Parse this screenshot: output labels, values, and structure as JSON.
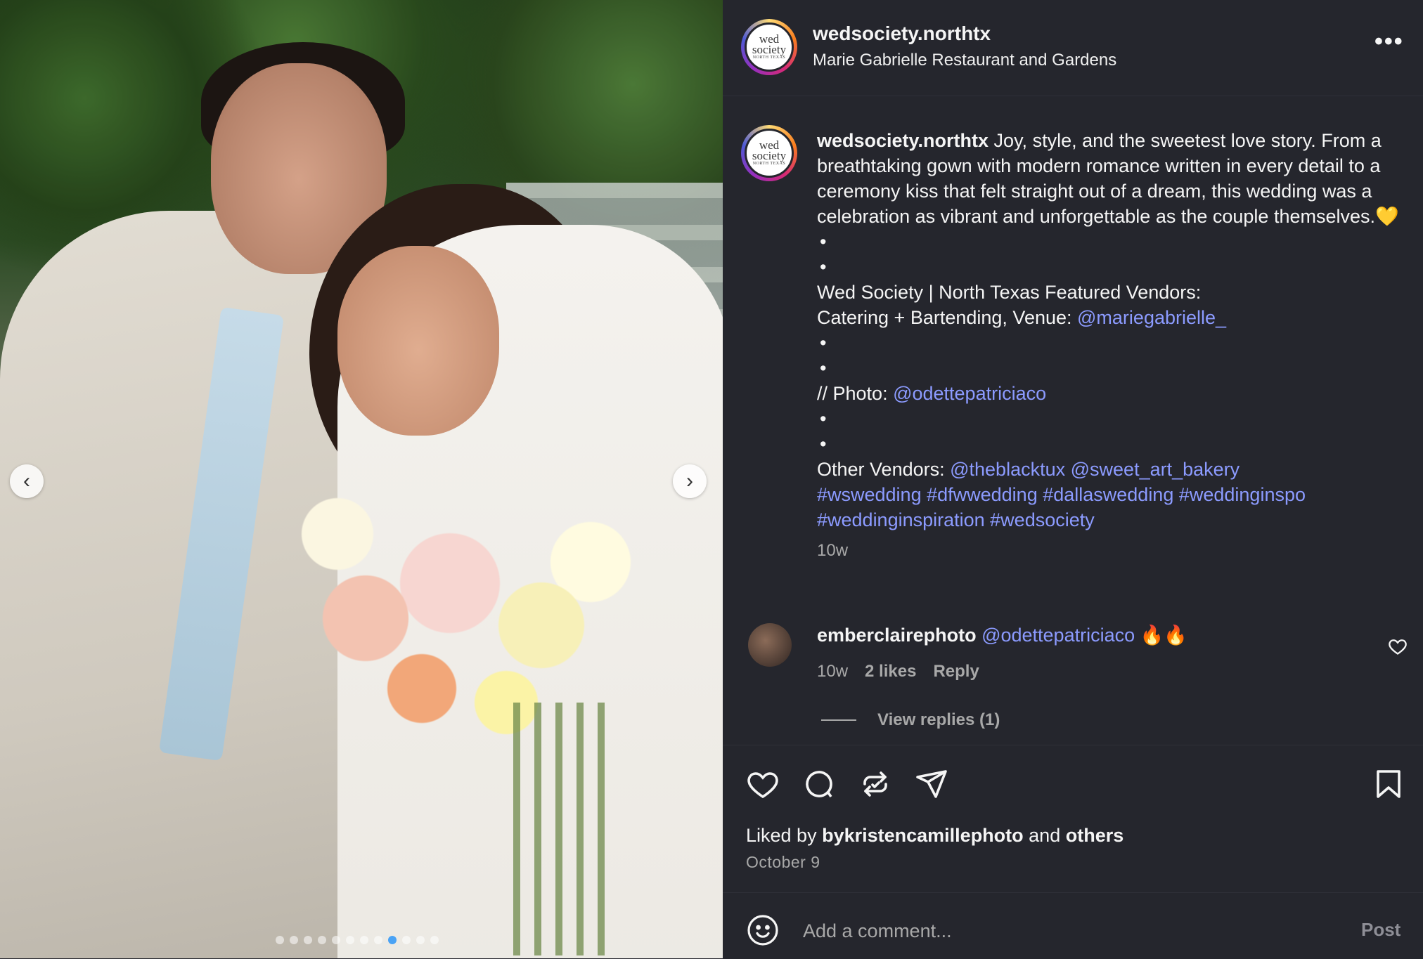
{
  "post": {
    "username": "wedsociety.northtx",
    "location": "Marie Gabrielle Restaurant and Gardens",
    "more_label": "•••",
    "avatar_text_top": "wed",
    "avatar_text_mid": "society",
    "avatar_text_small": "NORTH TEXAS"
  },
  "caption": {
    "username": "wedsociety.northtx",
    "intro": " Joy, style, and the sweetest love story. From a breathtaking gown with modern romance written in every detail to a ceremony kiss that felt straight out of a dream, this wedding was a celebration as vibrant and unforgettable as the couple themselves.💛",
    "bullet": "•",
    "vendors_heading": "Wed Society | North Texas Featured Vendors:",
    "vendors_line_prefix": "Catering + Bartending, Venue: ",
    "vendor_venue": "@mariegabrielle_",
    "photo_prefix": "// Photo: ",
    "photo_handle": "@odettepatriciaco",
    "other_prefix": "Other Vendors: ",
    "other_handle_1": "@theblacktux",
    "other_handle_2": "@sweet_art_bakery",
    "hashtags_line_1": "#wswedding #dfwwedding #dallaswedding #weddinginspo",
    "hashtags_line_2": "#weddinginspiration #wedsociety",
    "time": "10w"
  },
  "comment": {
    "username": "emberclairephoto",
    "mention": "@odettepatriciaco",
    "emoji": "🔥🔥",
    "time": "10w",
    "likes": "2 likes",
    "reply_label": "Reply",
    "view_replies": "View replies (1)"
  },
  "likes": {
    "prefix": "Liked by ",
    "user": "bykristencamillephoto",
    "middle": " and ",
    "others": "others"
  },
  "date": "October 9",
  "comment_box": {
    "placeholder": "Add a comment...",
    "post_label": "Post"
  },
  "carousel": {
    "total": 12,
    "active_index": 8,
    "prev_icon": "‹",
    "next_icon": "›"
  },
  "colors": {
    "background": "#25262d",
    "link": "#8c9bff",
    "muted": "#a8a8a8",
    "active_dot": "#4aa3f5"
  }
}
